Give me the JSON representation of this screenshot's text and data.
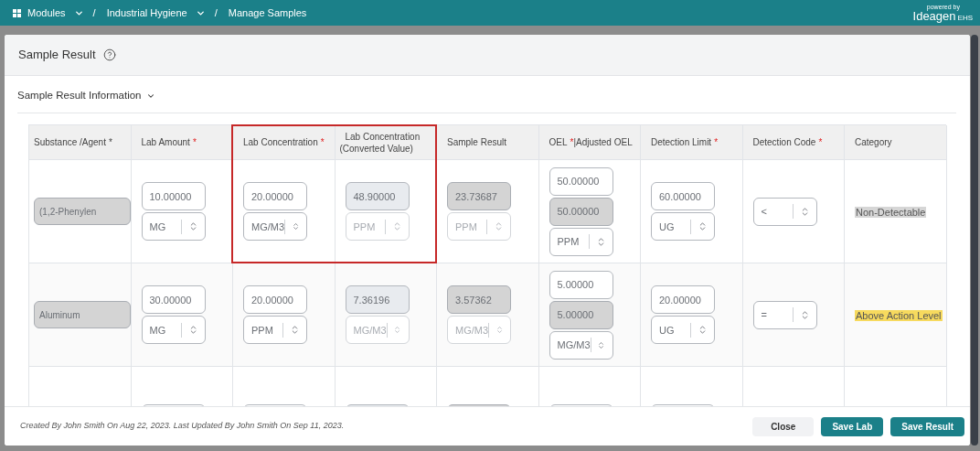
{
  "top_bar": {
    "breadcrumbs": [
      {
        "label": "Modules",
        "dropdown": true
      },
      {
        "label": "Industrial Hygiene",
        "dropdown": true
      },
      {
        "label": "Manage Samples",
        "dropdown": false
      }
    ],
    "separator": "/",
    "logo": {
      "tagline": "powered by",
      "name": "Ideagen",
      "suffix": "EHS"
    }
  },
  "dialog": {
    "title": "Sample Result",
    "section": {
      "title": "Sample Result Information",
      "expanded": true
    },
    "table": {
      "columns": [
        {
          "label": "Substance /Agent",
          "required_mark": "*",
          "highlighted": false
        },
        {
          "label": "Lab Amount",
          "required_mark": "*",
          "highlighted": false
        },
        {
          "label": "Lab Concentration",
          "required_mark": "*",
          "highlighted": true
        },
        {
          "label": "Lab Concentration (Converted Value)",
          "highlighted": true
        },
        {
          "label": "Sample Result",
          "highlighted": false
        },
        {
          "label": "OEL",
          "required_mark": "*",
          "suffix": "|Adjusted OEL",
          "highlighted": false
        },
        {
          "label": "Detection Limit",
          "required_mark": "*",
          "highlighted": false
        },
        {
          "label": "Detection Code",
          "required_mark": "*",
          "highlighted": false
        },
        {
          "label": "Category",
          "highlighted": false
        }
      ],
      "rows": [
        {
          "cells": [
            [
              {
                "kind": "chip",
                "value": "(1,2-Phenylen"
              }
            ],
            [
              {
                "kind": "input",
                "value": "10.00000"
              },
              {
                "kind": "select",
                "value": "MG",
                "disabled": false
              }
            ],
            [
              {
                "kind": "input",
                "value": "20.00000"
              },
              {
                "kind": "select",
                "value": "MG/M3",
                "disabled": false
              }
            ],
            [
              {
                "kind": "readonly",
                "value": "48.90000"
              },
              {
                "kind": "select",
                "value": "PPM",
                "disabled": true
              }
            ],
            [
              {
                "kind": "locked",
                "value": "23.73687"
              },
              {
                "kind": "select",
                "value": "PPM",
                "disabled": true
              }
            ],
            [
              {
                "kind": "input",
                "value": "50.00000"
              },
              {
                "kind": "locked",
                "value": "50.00000"
              },
              {
                "kind": "select",
                "value": "PPM",
                "disabled": false
              }
            ],
            [
              {
                "kind": "input",
                "value": "60.00000"
              },
              {
                "kind": "select",
                "value": "UG",
                "disabled": false
              }
            ],
            [
              {
                "kind": "select",
                "value": "<",
                "disabled": false
              }
            ],
            [
              {
                "kind": "tag",
                "value": "Non-Detectable",
                "color": "#d6d6d6"
              }
            ]
          ]
        },
        {
          "cells": [
            [
              {
                "kind": "chip",
                "value": "Aluminum"
              }
            ],
            [
              {
                "kind": "input",
                "value": "30.00000"
              },
              {
                "kind": "select",
                "value": "MG",
                "disabled": false
              }
            ],
            [
              {
                "kind": "input",
                "value": "20.00000"
              },
              {
                "kind": "select",
                "value": "PPM",
                "disabled": false
              }
            ],
            [
              {
                "kind": "readonly",
                "value": "7.36196"
              },
              {
                "kind": "select",
                "value": "MG/M3",
                "disabled": true
              }
            ],
            [
              {
                "kind": "locked",
                "value": "3.57362"
              },
              {
                "kind": "select",
                "value": "MG/M3",
                "disabled": true
              }
            ],
            [
              {
                "kind": "input",
                "value": "5.00000"
              },
              {
                "kind": "locked",
                "value": "5.00000"
              },
              {
                "kind": "select",
                "value": "MG/M3",
                "disabled": false
              }
            ],
            [
              {
                "kind": "input",
                "value": "20.00000"
              },
              {
                "kind": "select",
                "value": "UG",
                "disabled": false
              }
            ],
            [
              {
                "kind": "select",
                "value": "=",
                "disabled": false
              }
            ],
            [
              {
                "kind": "tag",
                "value": "Above Action Level",
                "color": "#f7da5e"
              }
            ]
          ]
        },
        {
          "cells": [
            [],
            [
              {
                "kind": "input"
              }
            ],
            [
              {
                "kind": "input"
              }
            ],
            [
              {
                "kind": "readonly"
              }
            ],
            [
              {
                "kind": "locked"
              }
            ],
            [
              {
                "kind": "input"
              }
            ],
            [
              {
                "kind": "input"
              }
            ],
            [],
            []
          ]
        }
      ]
    },
    "footer": {
      "audit": "Created By John Smith On Aug 22, 2023. Last Updated By John Smith On Sep 11, 2023.",
      "buttons": [
        {
          "label": "Close",
          "kind": "secondary"
        },
        {
          "label": "Save Lab",
          "kind": "primary"
        },
        {
          "label": "Save Result",
          "kind": "primary"
        }
      ]
    }
  }
}
